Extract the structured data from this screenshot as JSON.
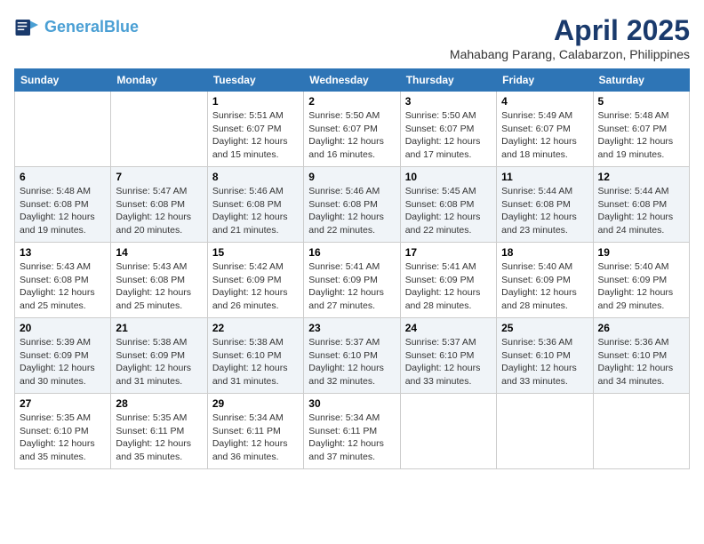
{
  "logo": {
    "line1": "General",
    "line2": "Blue"
  },
  "title": "April 2025",
  "location": "Mahabang Parang, Calabarzon, Philippines",
  "weekdays": [
    "Sunday",
    "Monday",
    "Tuesday",
    "Wednesday",
    "Thursday",
    "Friday",
    "Saturday"
  ],
  "weeks": [
    [
      {
        "day": "",
        "info": ""
      },
      {
        "day": "",
        "info": ""
      },
      {
        "day": "1",
        "info": "Sunrise: 5:51 AM\nSunset: 6:07 PM\nDaylight: 12 hours and 15 minutes."
      },
      {
        "day": "2",
        "info": "Sunrise: 5:50 AM\nSunset: 6:07 PM\nDaylight: 12 hours and 16 minutes."
      },
      {
        "day": "3",
        "info": "Sunrise: 5:50 AM\nSunset: 6:07 PM\nDaylight: 12 hours and 17 minutes."
      },
      {
        "day": "4",
        "info": "Sunrise: 5:49 AM\nSunset: 6:07 PM\nDaylight: 12 hours and 18 minutes."
      },
      {
        "day": "5",
        "info": "Sunrise: 5:48 AM\nSunset: 6:07 PM\nDaylight: 12 hours and 19 minutes."
      }
    ],
    [
      {
        "day": "6",
        "info": "Sunrise: 5:48 AM\nSunset: 6:08 PM\nDaylight: 12 hours and 19 minutes."
      },
      {
        "day": "7",
        "info": "Sunrise: 5:47 AM\nSunset: 6:08 PM\nDaylight: 12 hours and 20 minutes."
      },
      {
        "day": "8",
        "info": "Sunrise: 5:46 AM\nSunset: 6:08 PM\nDaylight: 12 hours and 21 minutes."
      },
      {
        "day": "9",
        "info": "Sunrise: 5:46 AM\nSunset: 6:08 PM\nDaylight: 12 hours and 22 minutes."
      },
      {
        "day": "10",
        "info": "Sunrise: 5:45 AM\nSunset: 6:08 PM\nDaylight: 12 hours and 22 minutes."
      },
      {
        "day": "11",
        "info": "Sunrise: 5:44 AM\nSunset: 6:08 PM\nDaylight: 12 hours and 23 minutes."
      },
      {
        "day": "12",
        "info": "Sunrise: 5:44 AM\nSunset: 6:08 PM\nDaylight: 12 hours and 24 minutes."
      }
    ],
    [
      {
        "day": "13",
        "info": "Sunrise: 5:43 AM\nSunset: 6:08 PM\nDaylight: 12 hours and 25 minutes."
      },
      {
        "day": "14",
        "info": "Sunrise: 5:43 AM\nSunset: 6:08 PM\nDaylight: 12 hours and 25 minutes."
      },
      {
        "day": "15",
        "info": "Sunrise: 5:42 AM\nSunset: 6:09 PM\nDaylight: 12 hours and 26 minutes."
      },
      {
        "day": "16",
        "info": "Sunrise: 5:41 AM\nSunset: 6:09 PM\nDaylight: 12 hours and 27 minutes."
      },
      {
        "day": "17",
        "info": "Sunrise: 5:41 AM\nSunset: 6:09 PM\nDaylight: 12 hours and 28 minutes."
      },
      {
        "day": "18",
        "info": "Sunrise: 5:40 AM\nSunset: 6:09 PM\nDaylight: 12 hours and 28 minutes."
      },
      {
        "day": "19",
        "info": "Sunrise: 5:40 AM\nSunset: 6:09 PM\nDaylight: 12 hours and 29 minutes."
      }
    ],
    [
      {
        "day": "20",
        "info": "Sunrise: 5:39 AM\nSunset: 6:09 PM\nDaylight: 12 hours and 30 minutes."
      },
      {
        "day": "21",
        "info": "Sunrise: 5:38 AM\nSunset: 6:09 PM\nDaylight: 12 hours and 31 minutes."
      },
      {
        "day": "22",
        "info": "Sunrise: 5:38 AM\nSunset: 6:10 PM\nDaylight: 12 hours and 31 minutes."
      },
      {
        "day": "23",
        "info": "Sunrise: 5:37 AM\nSunset: 6:10 PM\nDaylight: 12 hours and 32 minutes."
      },
      {
        "day": "24",
        "info": "Sunrise: 5:37 AM\nSunset: 6:10 PM\nDaylight: 12 hours and 33 minutes."
      },
      {
        "day": "25",
        "info": "Sunrise: 5:36 AM\nSunset: 6:10 PM\nDaylight: 12 hours and 33 minutes."
      },
      {
        "day": "26",
        "info": "Sunrise: 5:36 AM\nSunset: 6:10 PM\nDaylight: 12 hours and 34 minutes."
      }
    ],
    [
      {
        "day": "27",
        "info": "Sunrise: 5:35 AM\nSunset: 6:10 PM\nDaylight: 12 hours and 35 minutes."
      },
      {
        "day": "28",
        "info": "Sunrise: 5:35 AM\nSunset: 6:11 PM\nDaylight: 12 hours and 35 minutes."
      },
      {
        "day": "29",
        "info": "Sunrise: 5:34 AM\nSunset: 6:11 PM\nDaylight: 12 hours and 36 minutes."
      },
      {
        "day": "30",
        "info": "Sunrise: 5:34 AM\nSunset: 6:11 PM\nDaylight: 12 hours and 37 minutes."
      },
      {
        "day": "",
        "info": ""
      },
      {
        "day": "",
        "info": ""
      },
      {
        "day": "",
        "info": ""
      }
    ]
  ]
}
